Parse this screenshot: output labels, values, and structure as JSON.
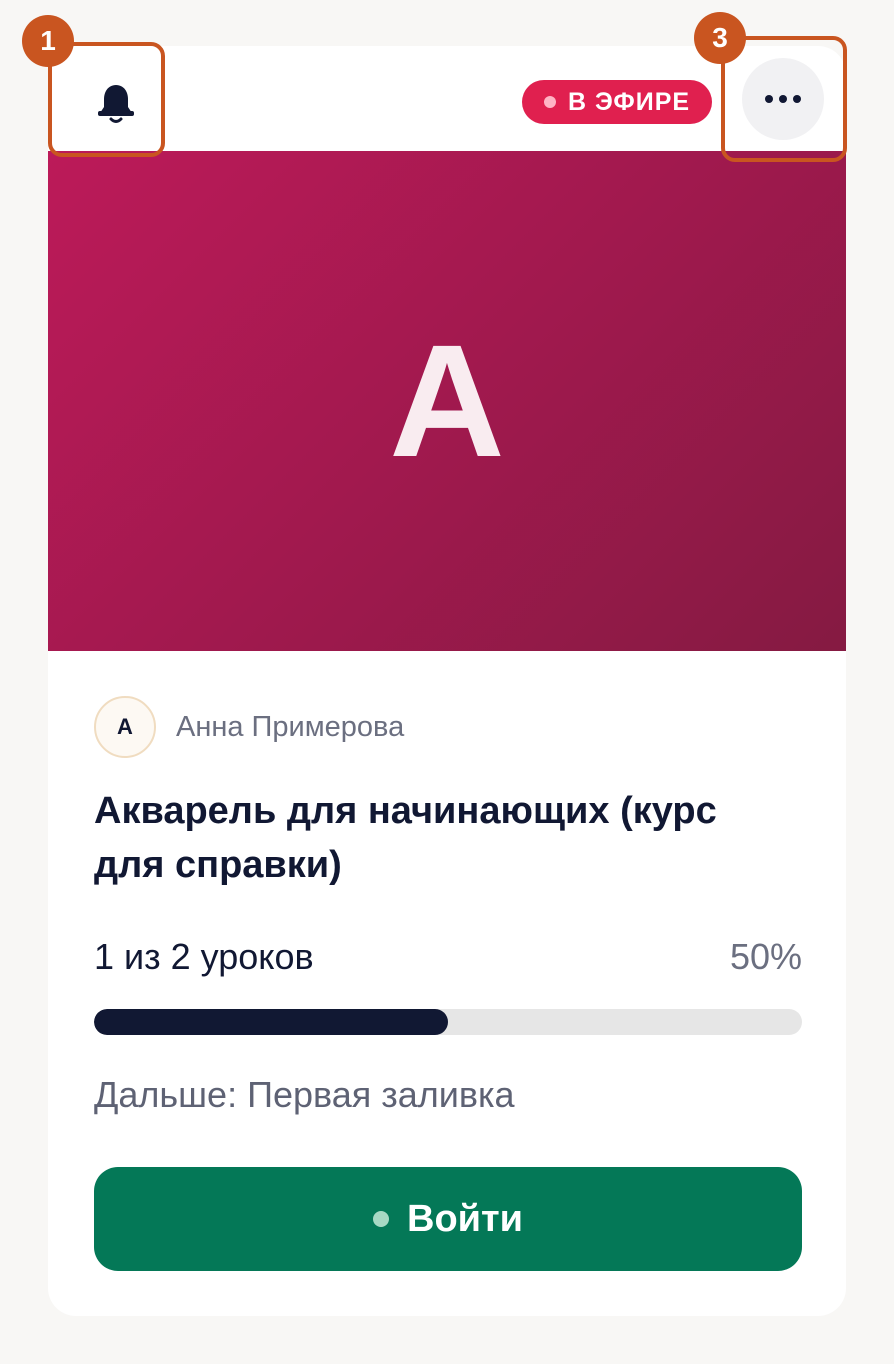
{
  "header": {
    "notifications_icon": "bell-icon",
    "live_label": "В ЭФИРЕ",
    "more_icon": "more-horizontal-icon"
  },
  "cover": {
    "letter": "A",
    "gradient": [
      "#bc1a59",
      "#851a42"
    ]
  },
  "author": {
    "initial": "A",
    "name": "Анна Примерова"
  },
  "course": {
    "title": "Акварель для начинающих (курс для справки)"
  },
  "progress": {
    "lessons_text": "1 из 2 уроков",
    "percent_text": "50%",
    "fraction": 0.5
  },
  "next": {
    "text": "Дальше: Первая заливка"
  },
  "action": {
    "enter_label": "Войти"
  },
  "annotations": {
    "marker_1": "1",
    "marker_3": "3"
  },
  "colors": {
    "live": "#e0204f",
    "primary_text": "#111833",
    "action": "#047857",
    "annotation": "#c95520"
  }
}
